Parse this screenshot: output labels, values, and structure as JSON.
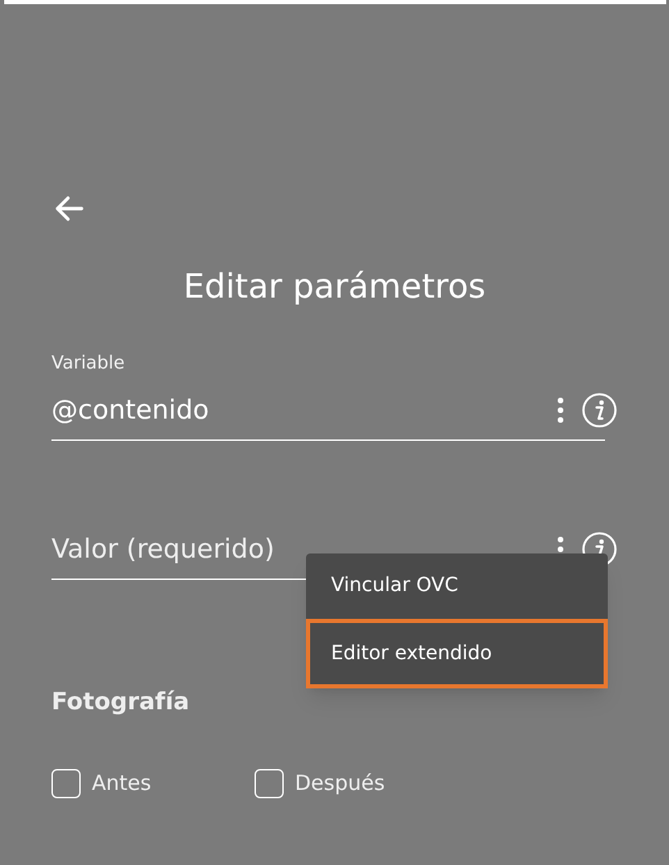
{
  "title": "Editar parámetros",
  "fields": [
    {
      "label": "Variable",
      "value": "@contenido"
    },
    {
      "placeholder": "Valor (requerido)"
    }
  ],
  "menu": [
    {
      "label": "Vincular OVC",
      "selected": false
    },
    {
      "label": "Editor extendido",
      "selected": true
    }
  ],
  "section": {
    "title": "Fotografía"
  },
  "checkboxes": [
    {
      "label": "Antes",
      "checked": false
    },
    {
      "label": "Después",
      "checked": false
    }
  ]
}
